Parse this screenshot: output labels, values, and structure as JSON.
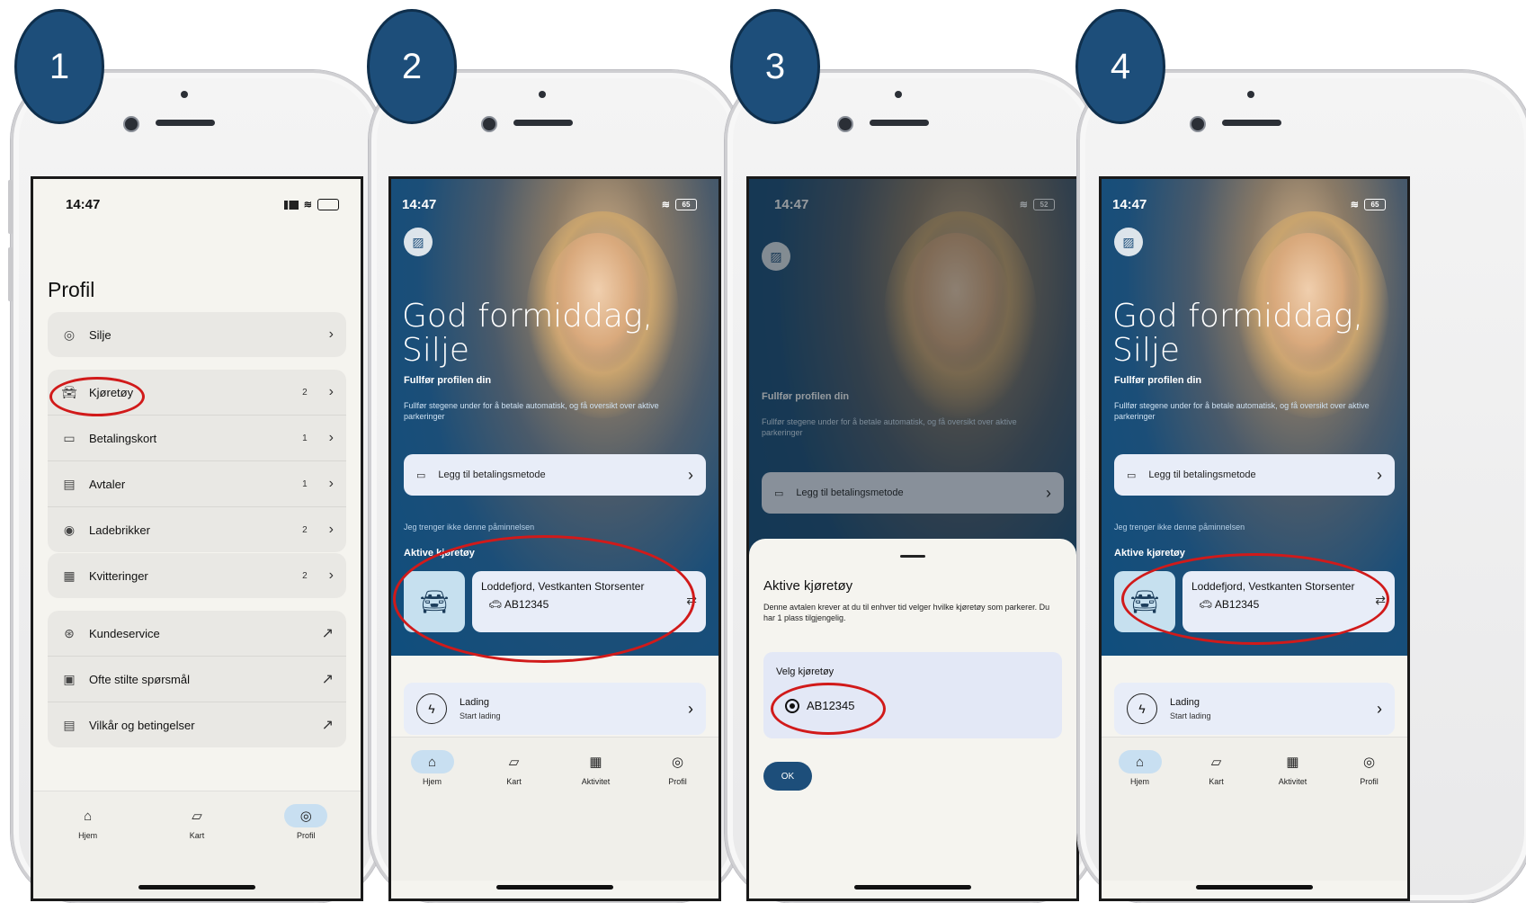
{
  "steps": [
    "1",
    "2",
    "3",
    "4"
  ],
  "status": {
    "time": "14:47",
    "battery": "65",
    "battery3": "52"
  },
  "screen1": {
    "title": "Profil",
    "user": {
      "label": "Silje"
    },
    "group1": [
      {
        "label": "Kjøretøy",
        "count": "2"
      },
      {
        "label": "Betalingskort",
        "count": "1"
      },
      {
        "label": "Avtaler",
        "count": "1"
      },
      {
        "label": "Ladebrikker",
        "count": "2"
      }
    ],
    "receipts": {
      "label": "Kvitteringer",
      "count": "2"
    },
    "links": [
      {
        "label": "Kundeservice"
      },
      {
        "label": "Ofte stilte spørsmål"
      },
      {
        "label": "Vilkår og betingelser"
      }
    ],
    "tabs": [
      "Hjem",
      "Kart",
      "Profil"
    ]
  },
  "home": {
    "greeting_line1": "God formiddag,",
    "greeting_line2": "Silje",
    "complete_profile": "Fullfør profilen din",
    "steps_desc": "Fullfør stegene under for å betale automatisk, og få oversikt over aktive parkeringer",
    "add_payment": "Legg til betalingsmetode",
    "no_reminder": "Jeg trenger ikke denne påminnelsen",
    "active_vehicles": "Aktive kjøretøy",
    "location": "Loddefjord, Vestkanten Storsenter",
    "plate": "AB12345",
    "charging_title": "Lading",
    "charging_sub": "Start lading",
    "tabs": [
      "Hjem",
      "Kart",
      "Aktivitet",
      "Profil"
    ]
  },
  "sheet": {
    "title": "Aktive kjøretøy",
    "desc": "Denne avtalen krever at du til enhver tid velger hvilke kjøretøy som parkerer. Du har 1 plass tilgjengelig.",
    "select_label": "Velg kjøretøy",
    "plate": "AB12345",
    "ok": "OK"
  },
  "colors": {
    "badge": "#1d4e7a",
    "highlight": "#d11a1a",
    "accent": "#1d4e7a"
  }
}
